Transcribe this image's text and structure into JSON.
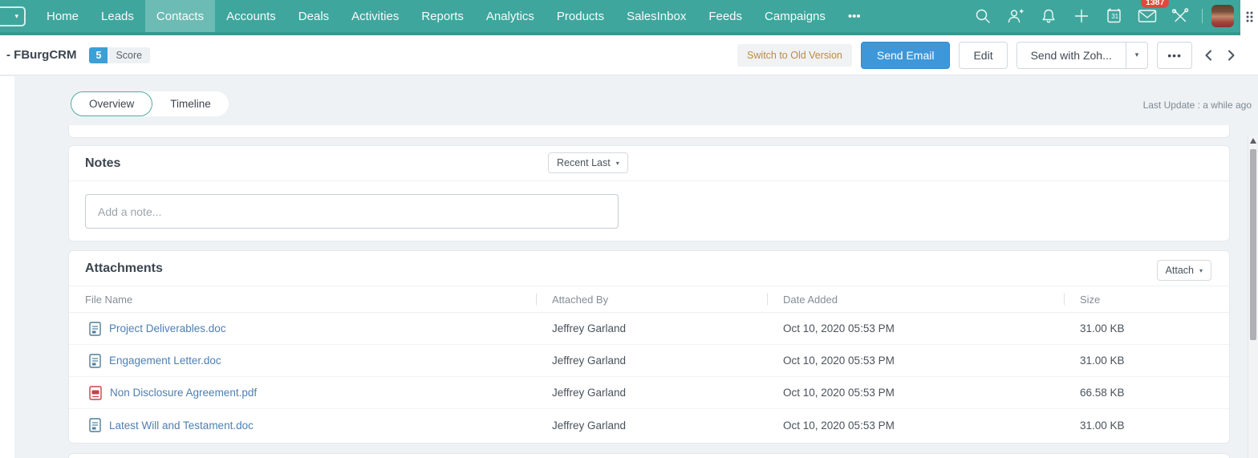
{
  "glyphs": {
    "caret_down": "▾"
  },
  "colors": {
    "teal": "#3FA69D",
    "teal_active_overlay": "rgba(255,255,255,0.24)",
    "teal_dark": "#37988F",
    "primary_blue": "#3E97D9",
    "link_blue": "#4D7FB3",
    "badge_red": "#E3473D",
    "score_blue": "#3B9FD8",
    "switch_orange": "#BE8A45",
    "page_bg": "#EEF2F5"
  },
  "nav": {
    "items": [
      {
        "label": "Home"
      },
      {
        "label": "Leads"
      },
      {
        "label": "Contacts",
        "active": true
      },
      {
        "label": "Accounts"
      },
      {
        "label": "Deals"
      },
      {
        "label": "Activities"
      },
      {
        "label": "Reports"
      },
      {
        "label": "Analytics"
      },
      {
        "label": "Products"
      },
      {
        "label": "SalesInbox"
      },
      {
        "label": "Feeds"
      },
      {
        "label": "Campaigns"
      },
      {
        "label": "•••"
      }
    ],
    "icons": [
      "search",
      "add-user",
      "notifications",
      "add",
      "calendar",
      "mail",
      "tools"
    ],
    "calendar_day": "31",
    "mail_badge": "1387"
  },
  "action_bar": {
    "record_title": "- FBurgCRM",
    "score_value": "5",
    "score_label": "Score",
    "switch_old_label": "Switch to Old Version",
    "send_email_label": "Send Email",
    "edit_label": "Edit",
    "send_with_label": "Send with Zoh...",
    "more_label": "•••"
  },
  "tabs": {
    "overview": "Overview",
    "timeline": "Timeline",
    "active": "Overview",
    "last_update": "Last Update : a while ago"
  },
  "notes": {
    "title": "Notes",
    "sort_label": "Recent Last",
    "note_placeholder": "Add a note..."
  },
  "attachments": {
    "title": "Attachments",
    "attach_label": "Attach",
    "columns": [
      "File Name",
      "Attached By",
      "Date Added",
      "Size"
    ],
    "rows": [
      {
        "file": "Project Deliverables.doc",
        "type": "doc",
        "attached_by": "Jeffrey Garland",
        "date": "Oct 10, 2020 05:53 PM",
        "size": "31.00 KB"
      },
      {
        "file": "Engagement Letter.doc",
        "type": "doc",
        "attached_by": "Jeffrey Garland",
        "date": "Oct 10, 2020 05:53 PM",
        "size": "31.00 KB"
      },
      {
        "file": "Non Disclosure Agreement.pdf",
        "type": "pdf",
        "attached_by": "Jeffrey Garland",
        "date": "Oct 10, 2020 05:53 PM",
        "size": "66.58 KB"
      },
      {
        "file": "Latest Will and Testament.doc",
        "type": "doc",
        "attached_by": "Jeffrey Garland",
        "date": "Oct 10, 2020 05:53 PM",
        "size": "31.00 KB"
      }
    ]
  }
}
